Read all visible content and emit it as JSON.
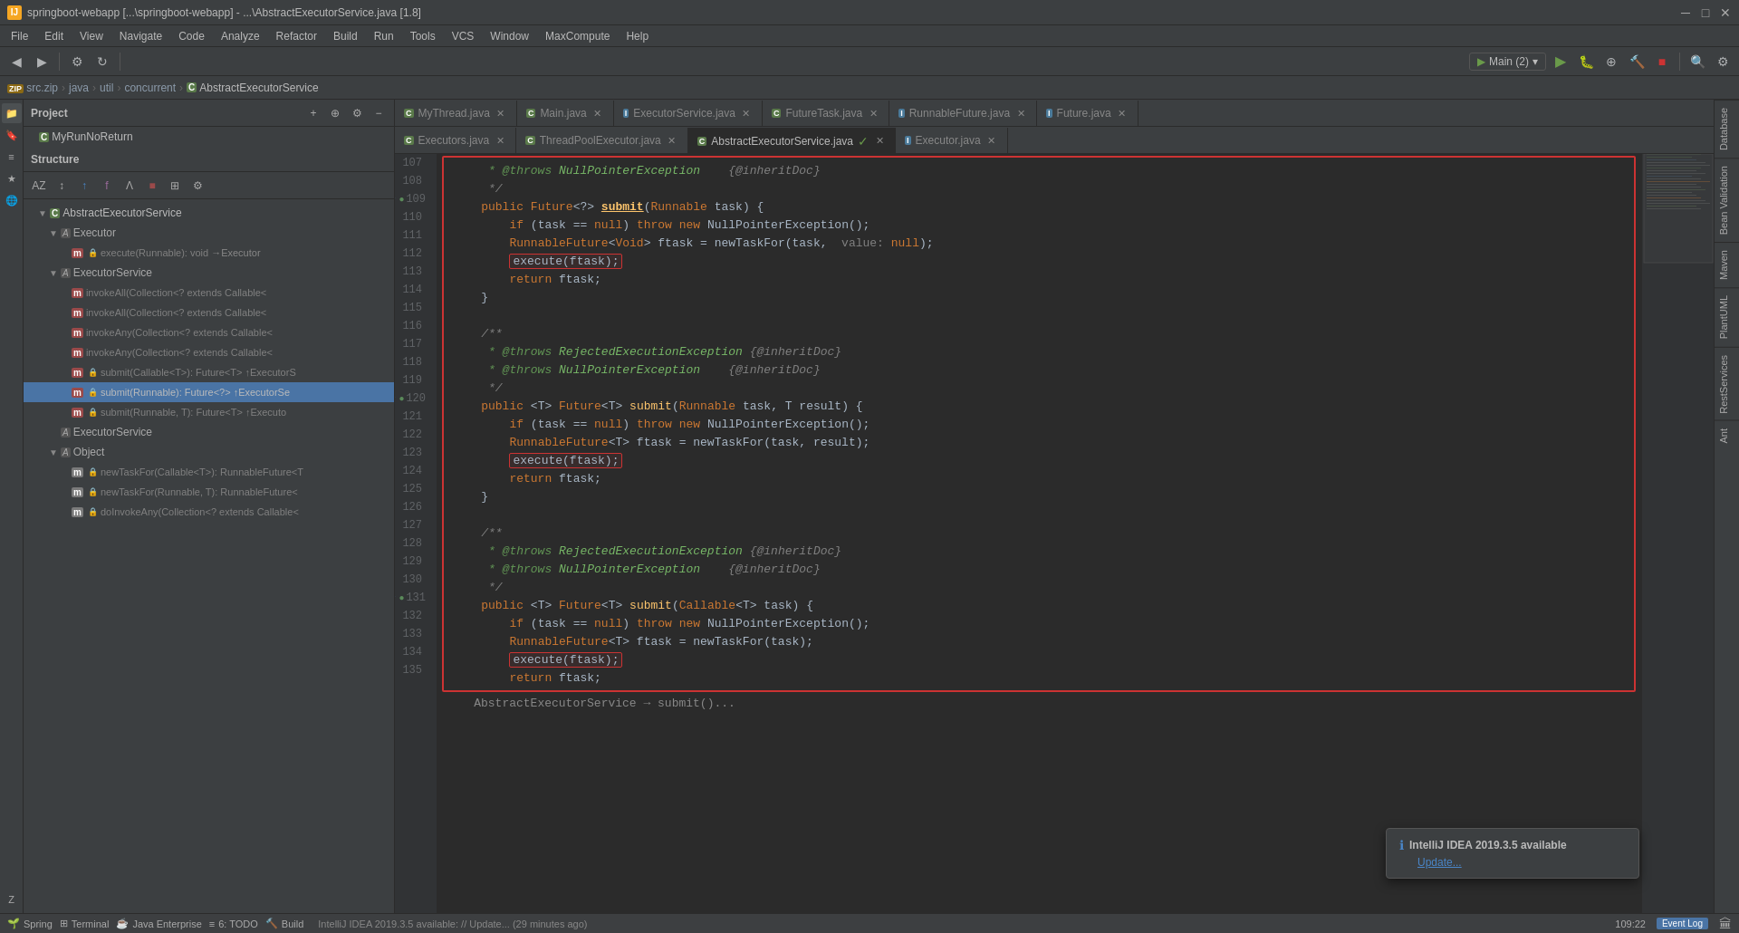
{
  "window": {
    "title": "springboot-webapp [...\\springboot-webapp] - ...\\AbstractExecutorService.java [1.8]",
    "icon": "IJ"
  },
  "menubar": {
    "items": [
      "File",
      "Edit",
      "View",
      "Navigate",
      "Code",
      "Analyze",
      "Refactor",
      "Build",
      "Run",
      "Tools",
      "VCS",
      "Window",
      "MaxCompute",
      "Help"
    ]
  },
  "breadcrumb": {
    "items": [
      "src.zip",
      "java",
      "util",
      "concurrent",
      "AbstractExecutorService"
    ]
  },
  "tabs_top": [
    {
      "label": "MyThread.java",
      "icon": "C",
      "active": false
    },
    {
      "label": "Main.java",
      "icon": "C",
      "active": false
    },
    {
      "label": "ExecutorService.java",
      "icon": "I",
      "active": false
    },
    {
      "label": "FutureTask.java",
      "icon": "C",
      "active": false
    },
    {
      "label": "RunnableFuture.java",
      "icon": "I",
      "active": false
    },
    {
      "label": "Future.java",
      "icon": "I",
      "active": false
    }
  ],
  "tabs_second": [
    {
      "label": "Executors.java",
      "icon": "C",
      "active": false
    },
    {
      "label": "ThreadPoolExecutor.java",
      "icon": "C",
      "active": false
    },
    {
      "label": "AbstractExecutorService.java",
      "icon": "C",
      "active": true
    },
    {
      "label": "Executor.java",
      "icon": "I",
      "active": false
    }
  ],
  "project_panel": {
    "title": "Project"
  },
  "structure_label": "Structure",
  "tree": [
    {
      "indent": 1,
      "icon": "C",
      "label": "AbstractExecutorService",
      "type": "class",
      "expanded": true
    },
    {
      "indent": 2,
      "icon": "I",
      "label": "Executor",
      "type": "interface",
      "expanded": true
    },
    {
      "indent": 3,
      "icon": "m",
      "label": "execute(Runnable): void →Executor",
      "type": "method"
    },
    {
      "indent": 2,
      "icon": "I",
      "label": "ExecutorService",
      "type": "interface",
      "expanded": true
    },
    {
      "indent": 3,
      "icon": "m",
      "label": "invokeAll(Collection<? extends Callable<",
      "type": "method"
    },
    {
      "indent": 3,
      "icon": "m",
      "label": "invokeAll(Collection<? extends Callable<",
      "type": "method"
    },
    {
      "indent": 3,
      "icon": "m",
      "label": "invokeAny(Collection<? extends Callable<",
      "type": "method"
    },
    {
      "indent": 3,
      "icon": "m",
      "label": "invokeAny(Collection<? extends Callable<",
      "type": "method"
    },
    {
      "indent": 3,
      "icon": "m",
      "label": "submit(Callable<T>): Future<T> ↑ExecutorS",
      "type": "method"
    },
    {
      "indent": 3,
      "icon": "m",
      "label": "submit(Runnable): Future<?> ↑ExecutorSe",
      "type": "method",
      "selected": true
    },
    {
      "indent": 3,
      "icon": "m",
      "label": "submit(Runnable, T): Future<T> ↑Executo",
      "type": "method"
    },
    {
      "indent": 2,
      "icon": "I",
      "label": "ExecutorService",
      "type": "interface"
    },
    {
      "indent": 2,
      "icon": "I",
      "label": "Object",
      "type": "class"
    },
    {
      "indent": 3,
      "icon": "m",
      "label": "newTaskFor(Callable<T>): RunnableFuture<T",
      "type": "method"
    },
    {
      "indent": 3,
      "icon": "m",
      "label": "newTaskFor(Runnable, T): RunnableFuture<",
      "type": "method"
    },
    {
      "indent": 3,
      "icon": "m",
      "label": "doInvokeAny(Collection<? extends Callable<",
      "type": "method"
    }
  ],
  "code": {
    "lines": [
      {
        "num": 107,
        "content": "     * @throws NullPointerException    {@inheritDoc}",
        "type": "javadoc"
      },
      {
        "num": 108,
        "content": "     */",
        "type": "comment"
      },
      {
        "num": 109,
        "content": "    public Future<?> submit(Runnable task) {",
        "type": "code",
        "gutter": [
          "impl",
          "debug"
        ]
      },
      {
        "num": 110,
        "content": "        if (task == null) throw new NullPointerException();",
        "type": "code"
      },
      {
        "num": 111,
        "content": "        RunnableFuture<Void> ftask = newTaskFor(task,  value: null);",
        "type": "code"
      },
      {
        "num": 112,
        "content": "        execute(ftask);",
        "type": "code",
        "highlight": "execute"
      },
      {
        "num": 113,
        "content": "        return ftask;",
        "type": "code"
      },
      {
        "num": 114,
        "content": "    }",
        "type": "code"
      },
      {
        "num": 115,
        "content": "",
        "type": "empty"
      },
      {
        "num": 116,
        "content": "",
        "type": "empty"
      },
      {
        "num": 117,
        "content": "     * @throws RejectedExecutionException {@inheritDoc}",
        "type": "javadoc"
      },
      {
        "num": 118,
        "content": "     * @throws NullPointerException    {@inheritDoc}",
        "type": "javadoc"
      },
      {
        "num": 119,
        "content": "     */",
        "type": "comment"
      },
      {
        "num": 120,
        "content": "    public <T> Future<T> submit(Runnable task, T result) {",
        "type": "code",
        "gutter": [
          "impl",
          "debug"
        ]
      },
      {
        "num": 121,
        "content": "        if (task == null) throw new NullPointerException();",
        "type": "code"
      },
      {
        "num": 122,
        "content": "        RunnableFuture<T> ftask = newTaskFor(task, result);",
        "type": "code"
      },
      {
        "num": 123,
        "content": "        execute(ftask);",
        "type": "code",
        "highlight": "execute"
      },
      {
        "num": 124,
        "content": "        return ftask;",
        "type": "code"
      },
      {
        "num": 125,
        "content": "    }",
        "type": "code"
      },
      {
        "num": 126,
        "content": "",
        "type": "empty"
      },
      {
        "num": 127,
        "content": "    /**",
        "type": "comment"
      },
      {
        "num": 128,
        "content": "     * @throws RejectedExecutionException {@inheritDoc}",
        "type": "javadoc"
      },
      {
        "num": 129,
        "content": "     * @throws NullPointerException    {@inheritDoc}",
        "type": "javadoc"
      },
      {
        "num": 130,
        "content": "     */",
        "type": "comment"
      },
      {
        "num": 131,
        "content": "    public <T> Future<T> submit(Callable<T> task) {",
        "type": "code",
        "gutter": [
          "impl",
          "debug"
        ]
      },
      {
        "num": 132,
        "content": "        if (task == null) throw new NullPointerException();",
        "type": "code"
      },
      {
        "num": 133,
        "content": "        RunnableFuture<T> ftask = newTaskFor(task);",
        "type": "code"
      },
      {
        "num": 134,
        "content": "        execute(ftask);",
        "type": "code",
        "highlight": "execute"
      },
      {
        "num": 135,
        "content": "        return ftask;",
        "type": "code"
      }
    ]
  },
  "right_panels": [
    "Database",
    "Bean Validation",
    "Maven",
    "PlantUML",
    "RestServices",
    "Ant"
  ],
  "status_bar": {
    "spring_label": "Spring",
    "terminal_label": "Terminal",
    "java_enterprise_label": "Java Enterprise",
    "todo_label": "6: TODO",
    "build_label": "Build",
    "position": "109:22",
    "event_log": "Event Log",
    "status_text": "IntelliJ IDEA 2019.3.5 available: // Update... (29 minutes ago)"
  },
  "notification": {
    "title": "IntelliJ IDEA 2019.3.5 available",
    "link": "Update..."
  },
  "toolbar": {
    "run_config": "Main (2)"
  }
}
